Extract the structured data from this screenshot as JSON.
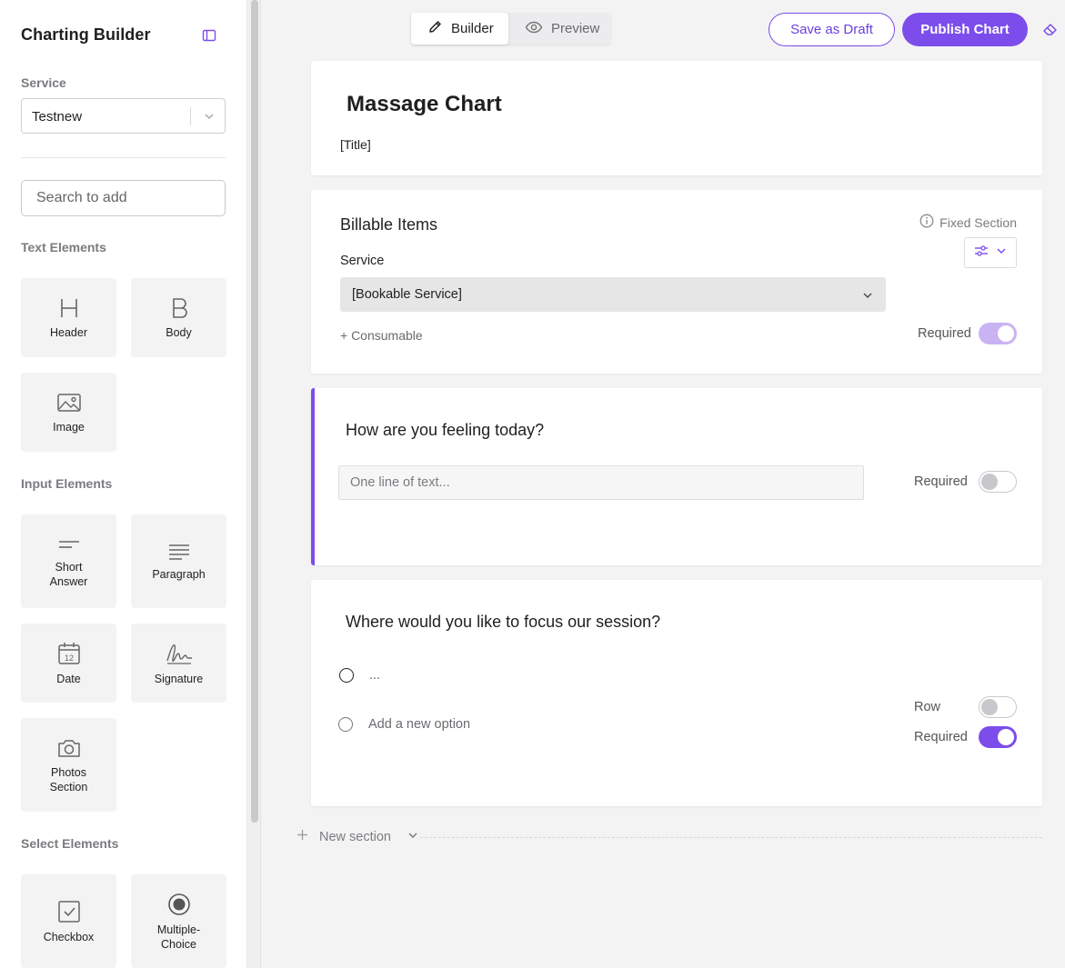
{
  "sidebar": {
    "title": "Charting Builder",
    "service_label": "Service",
    "service_value": "Testnew",
    "search_placeholder": "Search to add",
    "text_elements_label": "Text Elements",
    "text_elements": [
      {
        "label": "Header",
        "icon": "header-icon"
      },
      {
        "label": "Body",
        "icon": "body-icon"
      },
      {
        "label": "Image",
        "icon": "image-icon"
      }
    ],
    "input_elements_label": "Input Elements",
    "input_elements": [
      {
        "label": "Short Answer",
        "icon": "short-answer-icon"
      },
      {
        "label": "Paragraph",
        "icon": "paragraph-icon"
      },
      {
        "label": "Date",
        "icon": "calendar-icon"
      },
      {
        "label": "Signature",
        "icon": "signature-icon"
      },
      {
        "label": "Photos Section",
        "icon": "camera-icon"
      }
    ],
    "select_elements_label": "Select Elements",
    "select_elements": [
      {
        "label": "Checkbox",
        "icon": "checkbox-icon"
      },
      {
        "label": "Multiple-Choice",
        "icon": "radio-icon"
      }
    ],
    "date_icon_number": "12"
  },
  "toolbar": {
    "builder_label": "Builder",
    "preview_label": "Preview",
    "save_draft_label": "Save as Draft",
    "publish_label": "Publish Chart"
  },
  "chart": {
    "title": "Massage Chart",
    "subtitle": "[Title]"
  },
  "billable": {
    "heading": "Billable Items",
    "fixed_label": "Fixed Section",
    "service_label": "Service",
    "service_value": "[Bookable Service]",
    "consumable_label": "+ Consumable",
    "required_label": "Required",
    "required_on": true
  },
  "question1": {
    "heading": "How are you feeling today?",
    "placeholder": "One line of text...",
    "required_label": "Required",
    "required_on": false
  },
  "question2": {
    "heading": "Where would you like to focus our session?",
    "option_text": "...",
    "add_option_label": "Add a new option",
    "row_label": "Row",
    "row_on": false,
    "required_label": "Required",
    "required_on": true
  },
  "new_section_label": "New section",
  "colors": {
    "accent": "#7c4dea",
    "accent_light": "#c9b3f3"
  }
}
